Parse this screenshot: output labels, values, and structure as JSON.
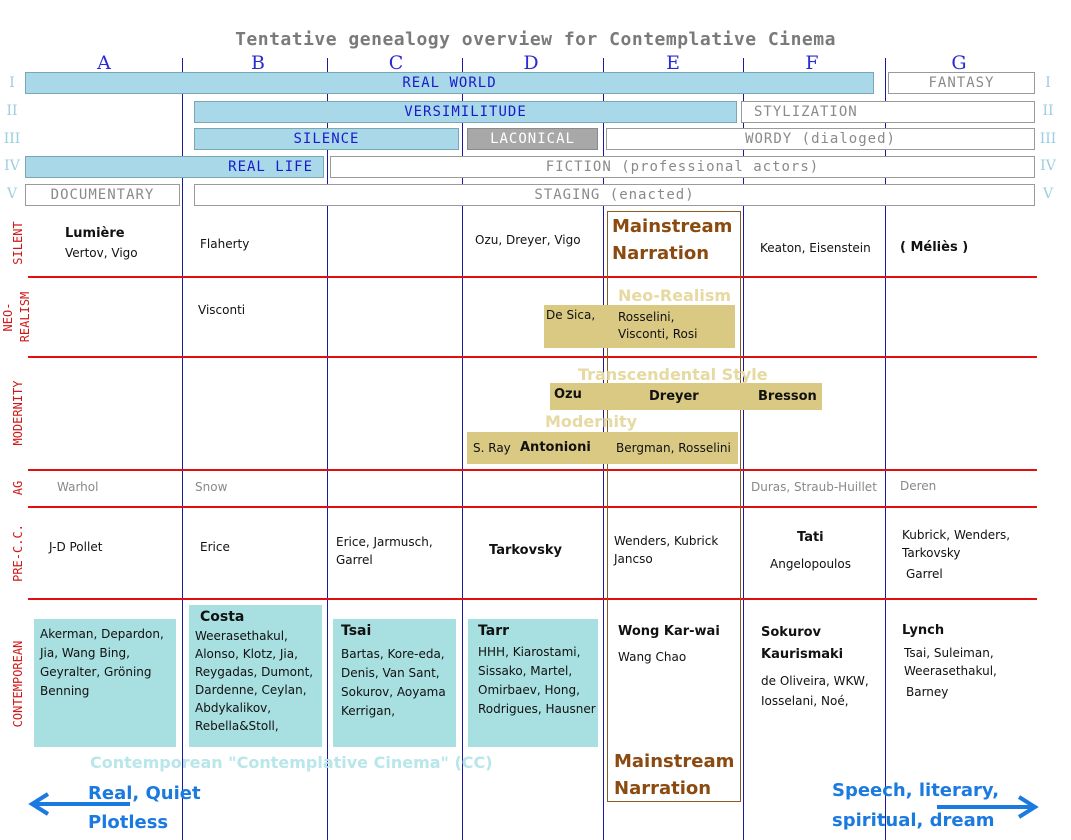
{
  "title": "Tentative genealogy overview for Contemplative Cinema",
  "columns": [
    "A",
    "B",
    "C",
    "D",
    "E",
    "F",
    "G"
  ],
  "roman_levels": [
    "I",
    "II",
    "III",
    "IV",
    "V"
  ],
  "bars": {
    "real_world": "REAL WORLD",
    "fantasy": "FANTASY",
    "versimilitude": "VERSIMILITUDE",
    "stylization": "STYLIZATION",
    "silence": "SILENCE",
    "laconical": "LACONICAL",
    "wordy": "WORDY (dialoged)",
    "real_life": "REAL LIFE",
    "fiction": "FICTION (professional actors)",
    "documentary": "DOCUMENTARY",
    "staging": "STAGING (enacted)"
  },
  "row_labels": {
    "silent": "SILENT",
    "neo_realism": [
      "NEO-",
      "REALISM"
    ],
    "modernity": "MODERNITY",
    "ag": "AG",
    "pre_cc": "PRE-C.C.",
    "contemporean": "CONTEMPOREAN"
  },
  "silent": {
    "a_main": "Lumière",
    "a_sub": "Vertov, Vigo",
    "b": "Flaherty",
    "d": "Ozu, Dreyer, Vigo",
    "f": "Keaton, Eisenstein",
    "g": "( Méliès )"
  },
  "mainstream": {
    "line1": "Mainstream",
    "line2": "Narration"
  },
  "neo": {
    "b": "Visconti",
    "label": "Neo-Realism",
    "d_box": "De Sica,",
    "e_box1": "Rosselini,",
    "e_box2": "Visconti, Rosi"
  },
  "modernity": {
    "transcendental_label": "Transcendental Style",
    "ozu": "Ozu",
    "dreyer": "Dreyer",
    "bresson": "Bresson",
    "modernity_label": "Modernity",
    "sray": "S. Ray",
    "antonioni": "Antonioni",
    "bergman": "Bergman, Rosselini"
  },
  "ag": {
    "a": "Warhol",
    "b": "Snow",
    "f": "Duras, Straub-Huillet",
    "g": "Deren"
  },
  "precc": {
    "a": "J-D Pollet",
    "b": "Erice",
    "c1": "Erice, Jarmusch,",
    "c2": "Garrel",
    "d": "Tarkovsky",
    "e1": "Wenders, Kubrick",
    "e2": "Jancso",
    "f_main": "Tati",
    "f_sub": "Angelopoulos",
    "g1": "Kubrick, Wenders,",
    "g2": "Tarkovsky",
    "g3": "Garrel"
  },
  "contemp": {
    "a": [
      "Akerman, Depardon,",
      "Jia, Wang Bing,",
      "Geyralter, Gröning",
      "Benning"
    ],
    "b_head": "Costa",
    "b": [
      "Weerasethakul,",
      "Alonso, Klotz, Jia,",
      "Reygadas, Dumont,",
      "Dardenne, Ceylan,",
      "Abdykalikov,",
      "Rebella&Stoll,"
    ],
    "c_head": "Tsai",
    "c": [
      "Bartas, Kore-eda,",
      "Denis, Van Sant,",
      "Sokurov, Aoyama",
      "Kerrigan,"
    ],
    "d_head": "Tarr",
    "d": [
      "HHH, Kiarostami,",
      "Sissako, Martel,",
      "Omirbaev, Hong,",
      "Rodrigues, Hausner"
    ],
    "e_head": "Wong Kar-wai",
    "e_sub": "Wang Chao",
    "f_head1": "Sokurov",
    "f_head2": "Kaurismaki",
    "f1": "de Oliveira, WKW,",
    "f2": "Iosselani, Noé,",
    "g_head": "Lynch",
    "g1": "Tsai, Suleiman,",
    "g2": "Weerasethakul,",
    "g3": "Barney"
  },
  "footer": {
    "cc_label": "Contemporean \"Contemplative Cinema\" (CC)",
    "left1": "Real, Quiet",
    "left2": "Plotless",
    "right1": "Speech, literary,",
    "right2": "spiritual, dream"
  },
  "colors": {
    "axis_blue": "#1a1aa0",
    "section_red": "#e01010",
    "contemp_box": "#a8dfe0",
    "tan_box": "#d9c983",
    "mainstream_brown": "#8b4a10",
    "arrow_blue": "#1a7ae0"
  }
}
